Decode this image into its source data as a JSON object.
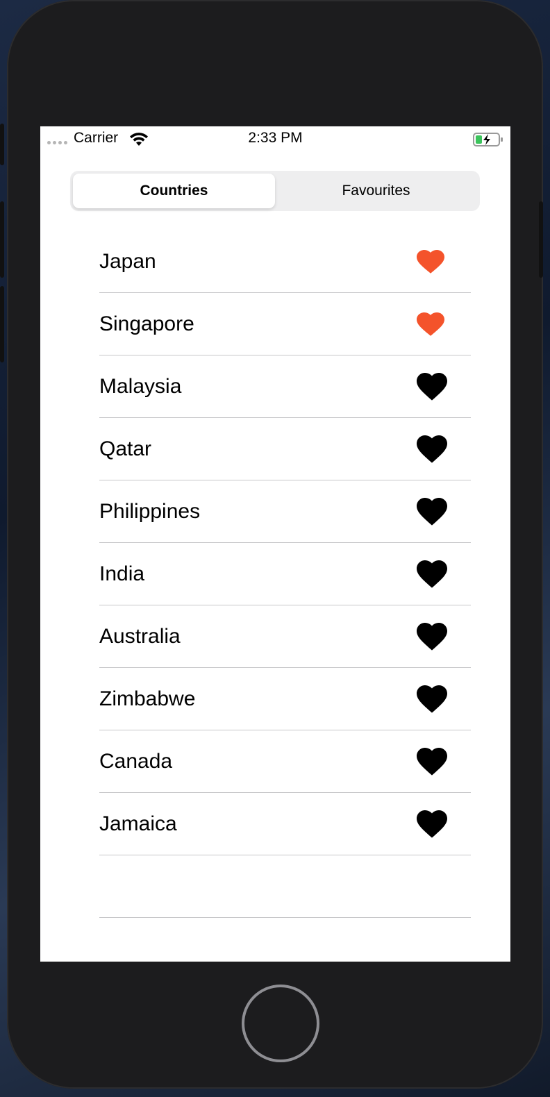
{
  "status_bar": {
    "carrier": "Carrier",
    "time": "2:33 PM",
    "battery_icon": "battery-charging-icon",
    "wifi_icon": "wifi-icon"
  },
  "segmented_control": {
    "selected_index": 0,
    "segments": [
      {
        "label": "Countries"
      },
      {
        "label": "Favourites"
      }
    ]
  },
  "colors": {
    "favourite_heart": "#f4532b",
    "default_heart": "#000000"
  },
  "countries": [
    {
      "name": "Japan",
      "favourite": true
    },
    {
      "name": "Singapore",
      "favourite": true
    },
    {
      "name": "Malaysia",
      "favourite": false
    },
    {
      "name": "Qatar",
      "favourite": false
    },
    {
      "name": "Philippines",
      "favourite": false
    },
    {
      "name": "India",
      "favourite": false
    },
    {
      "name": "Australia",
      "favourite": false
    },
    {
      "name": "Zimbabwe",
      "favourite": false
    },
    {
      "name": "Canada",
      "favourite": false
    },
    {
      "name": "Jamaica",
      "favourite": false
    }
  ]
}
